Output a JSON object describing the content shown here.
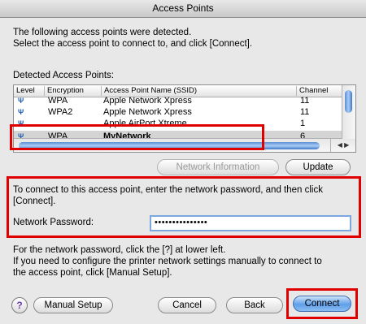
{
  "window": {
    "title": "Access Points"
  },
  "intro": {
    "line1": "The following access points were detected.",
    "line2": "Select the access point to connect to, and click [Connect]."
  },
  "list": {
    "label": "Detected Access Points:",
    "headers": {
      "level": "Level",
      "encryption": "Encryption",
      "ssid": "Access Point Name (SSID)",
      "channel": "Channel"
    },
    "rows": [
      {
        "encryption": "WPA",
        "ssid": "Apple Network Xpress",
        "channel": "11"
      },
      {
        "encryption": "WPA2",
        "ssid": "Apple Network Xpress",
        "channel": "11"
      },
      {
        "encryption": "",
        "ssid": "Apple AirPort Xtreme",
        "channel": "1"
      },
      {
        "encryption": "WPA",
        "ssid": "MyNetwork",
        "channel": "6",
        "selected": true
      }
    ]
  },
  "buttons": {
    "network_info": "Network Information",
    "update": "Update",
    "manual_setup": "Manual Setup",
    "cancel": "Cancel",
    "back": "Back",
    "connect": "Connect",
    "help": "?"
  },
  "password": {
    "instruction_line1": "To connect to this access point, enter the network password, and then click",
    "instruction_line2": "[Connect].",
    "label": "Network Password:",
    "value": "•••••••••••••••"
  },
  "footer": {
    "line1": "For the network password, click the [?] at lower left.",
    "line2": "If you need to configure the printer network settings manually to connect to",
    "line3": "the access point, click [Manual Setup]."
  },
  "colors": {
    "highlight": "#e00000",
    "accent": "#5f9fe8"
  },
  "icons": {
    "signal": "signal-strength-icon",
    "help": "help-icon"
  }
}
